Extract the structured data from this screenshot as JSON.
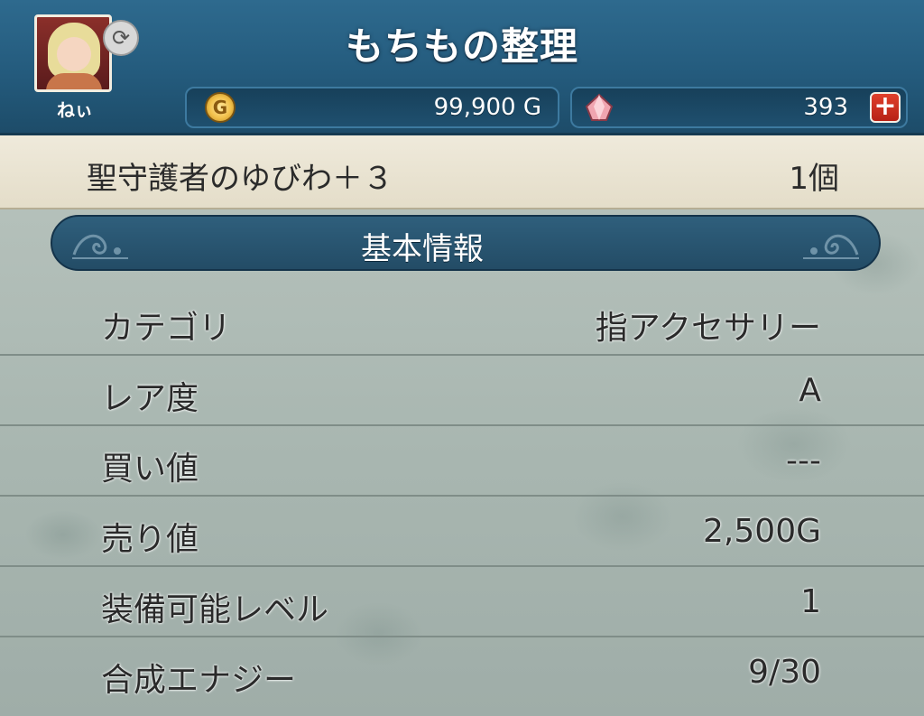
{
  "header": {
    "title": "もちもの整理",
    "player_name": "ねぃ",
    "gold": "99,900 G",
    "gems": "393"
  },
  "item": {
    "name": "聖守護者のゆびわ＋３",
    "count": "1個"
  },
  "section": {
    "title": "基本情報"
  },
  "details": [
    {
      "label": "カテゴリ",
      "value": "指アクセサリー"
    },
    {
      "label": "レア度",
      "value": "A"
    },
    {
      "label": "買い値",
      "value": "---"
    },
    {
      "label": "売り値",
      "value": "2,500G"
    },
    {
      "label": "装備可能レベル",
      "value": "1"
    },
    {
      "label": "合成エナジー",
      "value": "9/30"
    }
  ],
  "icons": {
    "swap": "swap-icon",
    "gold": "gold-coin-icon",
    "gem": "gem-icon",
    "add": "plus-icon"
  },
  "colors": {
    "header_bg": "#245b7d",
    "item_bar_bg": "#ebe5d3",
    "plus_button": "#d2301f"
  }
}
